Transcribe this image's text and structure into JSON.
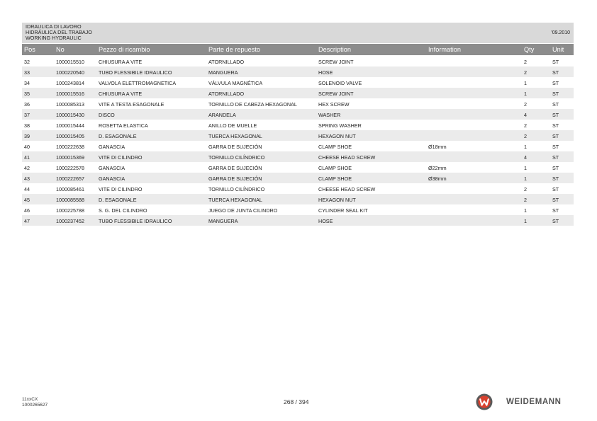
{
  "header": {
    "title_it": "IDRAULICA DI LAVORO",
    "title_es": "HIDRÁULICA DEL TRABAJO",
    "title_en": "WORKING HYDRAULIC",
    "date": "'09.2010"
  },
  "columns": {
    "pos": "Pos",
    "no": "No",
    "it": "Pezzo di ricambio",
    "es": "Parte de repuesto",
    "en": "Description",
    "info": "Information",
    "qty": "Qty",
    "unit": "Unit"
  },
  "rows": [
    {
      "pos": "32",
      "no": "1000015510",
      "it": "CHIUSURA A VITE",
      "es": "ATORNILLADO",
      "en": "SCREW JOINT",
      "info": "",
      "qty": "2",
      "unit": "ST"
    },
    {
      "pos": "33",
      "no": "1000220540",
      "it": "TUBO FLESSIBILE IDRAULICO",
      "es": "MANGUERA",
      "en": "HOSE",
      "info": "",
      "qty": "2",
      "unit": "ST"
    },
    {
      "pos": "34",
      "no": "1000243814",
      "it": "VALVOLA ELETTROMAGNETICA",
      "es": "VÁLVULA MAGNÉTICA",
      "en": "SOLENOID VALVE",
      "info": "",
      "qty": "1",
      "unit": "ST"
    },
    {
      "pos": "35",
      "no": "1000015516",
      "it": "CHIUSURA A VITE",
      "es": "ATORNILLADO",
      "en": "SCREW JOINT",
      "info": "",
      "qty": "1",
      "unit": "ST"
    },
    {
      "pos": "36",
      "no": "1000085313",
      "it": "VITE A TESTA ESAGONALE",
      "es": "TORNILLO DE CABEZA HEXAGONAL",
      "en": "HEX SCREW",
      "info": "",
      "qty": "2",
      "unit": "ST"
    },
    {
      "pos": "37",
      "no": "1000015430",
      "it": "DISCO",
      "es": "ARANDELA",
      "en": "WASHER",
      "info": "",
      "qty": "4",
      "unit": "ST"
    },
    {
      "pos": "38",
      "no": "1000015444",
      "it": "ROSETTA ELASTICA",
      "es": "ANILLO DE MUELLE",
      "en": "SPRING WASHER",
      "info": "",
      "qty": "2",
      "unit": "ST"
    },
    {
      "pos": "39",
      "no": "1000015405",
      "it": "D. ESAGONALE",
      "es": "TUERCA HEXAGONAL",
      "en": "HEXAGON NUT",
      "info": "",
      "qty": "2",
      "unit": "ST"
    },
    {
      "pos": "40",
      "no": "1000222638",
      "it": "GANASCIA",
      "es": "GARRA DE SUJECIÓN",
      "en": "CLAMP SHOE",
      "info": "Ø18mm",
      "qty": "1",
      "unit": "ST"
    },
    {
      "pos": "41",
      "no": "1000015369",
      "it": "VITE DI CILINDRO",
      "es": "TORNILLO CILÍNDRICO",
      "en": "CHEESE HEAD SCREW",
      "info": "",
      "qty": "4",
      "unit": "ST"
    },
    {
      "pos": "42",
      "no": "1000222578",
      "it": "GANASCIA",
      "es": "GARRA DE SUJECIÓN",
      "en": "CLAMP SHOE",
      "info": "Ø22mm",
      "qty": "1",
      "unit": "ST"
    },
    {
      "pos": "43",
      "no": "1000222657",
      "it": "GANASCIA",
      "es": "GARRA DE SUJECIÓN",
      "en": "CLAMP SHOE",
      "info": "Ø38mm",
      "qty": "1",
      "unit": "ST"
    },
    {
      "pos": "44",
      "no": "1000085461",
      "it": "VITE DI CILINDRO",
      "es": "TORNILLO CILÍNDRICO",
      "en": "CHEESE HEAD SCREW",
      "info": "",
      "qty": "2",
      "unit": "ST"
    },
    {
      "pos": "45",
      "no": "1000085588",
      "it": "D. ESAGONALE",
      "es": "TUERCA HEXAGONAL",
      "en": "HEXAGON NUT",
      "info": "",
      "qty": "2",
      "unit": "ST"
    },
    {
      "pos": "46",
      "no": "1000225788",
      "it": "S. G. DEL CILINDRO",
      "es": "JUEGO DE JUNTA CILINDRO",
      "en": "CYLINDER SEAL KIT",
      "info": "",
      "qty": "1",
      "unit": "ST"
    },
    {
      "pos": "47",
      "no": "1000237452",
      "it": "TUBO FLESSIBILE IDRAULICO",
      "es": "MANGUERA",
      "en": "HOSE",
      "info": "",
      "qty": "1",
      "unit": "ST"
    }
  ],
  "footer": {
    "model": "11xxCX",
    "doc_number": "1000265627",
    "page": "268 / 394",
    "brand": "WEIDEMANN",
    "logo_icon": "weidemann-w-logo-icon",
    "logo_color": "#d9412e"
  }
}
